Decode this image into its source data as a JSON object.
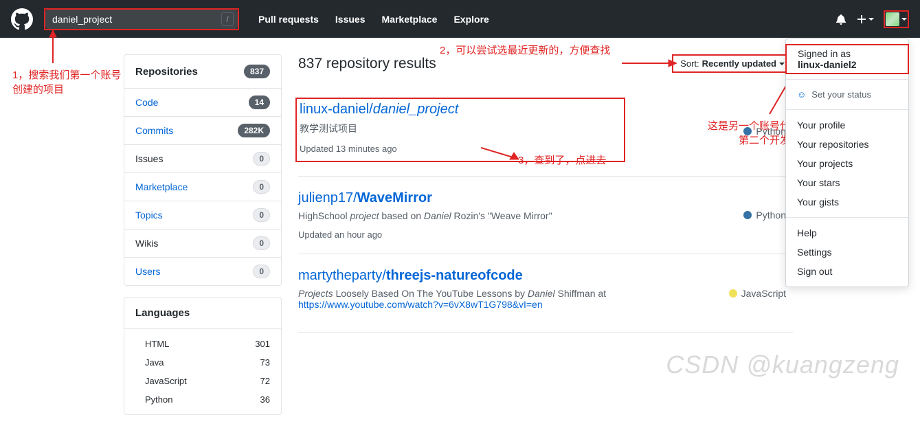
{
  "header": {
    "search_value": "daniel_project",
    "slash": "/",
    "nav": [
      "Pull requests",
      "Issues",
      "Marketplace",
      "Explore"
    ]
  },
  "sidebar": {
    "header": {
      "label": "Repositories",
      "count": "837"
    },
    "filters": [
      {
        "label": "Code",
        "count": "14",
        "link": true,
        "dark": true
      },
      {
        "label": "Commits",
        "count": "282K",
        "link": true,
        "dark": true
      },
      {
        "label": "Issues",
        "count": "0",
        "link": false,
        "dark": false
      },
      {
        "label": "Marketplace",
        "count": "0",
        "link": true,
        "dark": false
      },
      {
        "label": "Topics",
        "count": "0",
        "link": true,
        "dark": false
      },
      {
        "label": "Wikis",
        "count": "0",
        "link": false,
        "dark": false
      },
      {
        "label": "Users",
        "count": "0",
        "link": true,
        "dark": false
      }
    ],
    "lang_header": "Languages",
    "languages": [
      {
        "name": "HTML",
        "count": "301"
      },
      {
        "name": "Java",
        "count": "73"
      },
      {
        "name": "JavaScript",
        "count": "72"
      },
      {
        "name": "Python",
        "count": "36"
      }
    ]
  },
  "results": {
    "title": "837 repository results",
    "sort_label": "Sort:",
    "sort_value": "Recently updated",
    "repos": [
      {
        "owner": "linux-daniel/",
        "name": "daniel_project",
        "name_italic": true,
        "desc_plain": "教学测试项目",
        "updated": "Updated 13 minutes ago",
        "lang": "Python",
        "lang_class": "python",
        "boxed": true
      },
      {
        "owner": "julienp17/",
        "name": "WaveMirror",
        "name_bold": true,
        "desc_html": "HighSchool <span class=\"em\">project</span> based on <span class=\"em\">Daniel</span> Rozin's \"Weave Mirror\"",
        "updated": "Updated an hour ago",
        "lang": "Python",
        "lang_class": "python"
      },
      {
        "owner": "martytheparty/",
        "name": "threejs-natureofcode",
        "name_bold": true,
        "desc_html": "<span class=\"em\">Projects</span> Loosely Based On The YouTube Lessons by <span class=\"em\">Daniel</span> Shiffman at <a href=\"#\">https://www.youtube.com/watch?v=6vX8wT1G798&vI=en</a>",
        "updated": "",
        "lang": "JavaScript",
        "lang_class": "js"
      }
    ]
  },
  "dropdown": {
    "signed_label": "Signed in as",
    "username": "linux-daniel2",
    "status": "Set your status",
    "items1": [
      "Your profile",
      "Your repositories",
      "Your projects",
      "Your stars",
      "Your gists"
    ],
    "items2": [
      "Help",
      "Settings",
      "Sign out"
    ]
  },
  "annotations": {
    "a1": "1，搜索我们第一个账号创建的项目",
    "a2": "2，可以尝试选最近更新的，方便查找",
    "a3": "3，查到了，点进去",
    "a4": "这是另一个账号代表第二个开发者"
  },
  "watermark": "CSDN @kuangzeng"
}
